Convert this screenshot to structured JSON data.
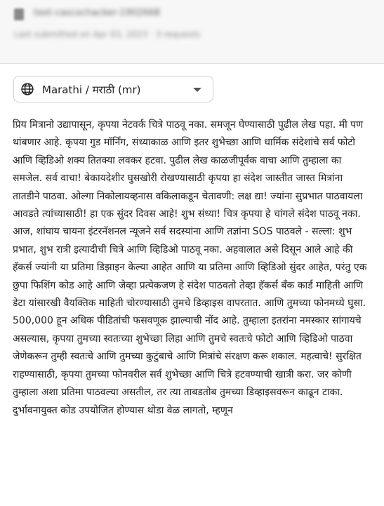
{
  "header": {
    "file_name": "text-cascochacker-1902668",
    "meta": "Last submitted on Apr 03, 2023 · 3 requests"
  },
  "language_select": {
    "icon": "globe-icon",
    "selected": "Marathi / मराठी (mr)"
  },
  "content": {
    "text": "प्रिय मित्रानो उद्यापासून, कृपया नेटवर्क चित्रे पाठवू नका. समजून घेण्यासाठी पुढील लेख पहा. मी पण थांबणार आहे. कृपया गुड मॉर्निंग, संध्याकाळ आणि इतर शुभेच्छा आणि धार्मिक संदेशांचे सर्व फोटो आणि व्हिडिओ शक्य तितक्या लवकर हटवा. पुढील लेख काळजीपूर्वक वाचा आणि तुम्हाला का समजेल. सर्व वाचा! बेकायदेशीर घुसखोरी रोखण्यासाठी कृपया हा संदेश जास्तीत जास्त मित्रांना तातडीने पाठवा. ओल्गा निकोलायव्हनास वकिलाकडून चेतावणी: लक्ष द्या! ज्यांना सुप्रभात पाठवायला आवडते त्यांच्यासाठी! हा एक सुंदर दिवस आहे! शुभ संध्या! चित्र कृपया हे चांगले संदेश पाठवू नका. आज, शांघाय चायना इंटरनॅशनल न्यूजने सर्व सदस्यांना आणि तज्ञांना SOS पाठवले - सल्ला: शुभ प्रभात, शुभ रात्री इत्यादीची चित्रे आणि व्हिडिओ पाठवू नका. अहवालात असे दिसून आले आहे की हॅकर्स ज्यांनी या प्रतिमा डिझाइन केल्या आहेत आणि या प्रतिमा आणि व्हिडिओ सुंदर आहेत, परंतु एक छुपा फिशिंग कोड आहे आणि जेव्हा प्रत्येकजण हे संदेश पाठवतो तेव्हा हॅकर्स बँक कार्ड माहिती आणि डेटा यांसारखी वैयक्तिक माहिती चोरण्यासाठी तुमचे डिव्हाइस वापरतात. आणि तुमच्या फोनमध्ये घुसा. 500,000 हून अधिक पीडितांची फसवणूक झाल्याची नोंद आहे. तुम्हाला इतरांना नमस्कार सांगायचे असल्यास, कृपया तुमच्या स्वतःच्या शुभेच्छा लिहा आणि तुमचे स्वतःचे फोटो आणि व्हिडिओ पाठवा जेणेकरून तुम्ही स्वतःचे आणि तुमच्या कुटुंबाचे आणि मित्रांचे संरक्षण करू शकाल. महत्वाचे! सुरक्षित राहण्यासाठी, कृपया तुमच्या फोनवरील सर्व शुभेच्छा आणि चित्रे हटवण्याची खात्री करा. जर कोणी तुम्हाला अशा प्रतिमा पाठवल्या असतील, तर त्या ताबडतोब तुमच्या डिव्हाइसवरून काढून टाका. दुर्भावनायुक्त कोड उपयोजित होण्यास थोडा वेळ लागतो, म्हणून"
  }
}
